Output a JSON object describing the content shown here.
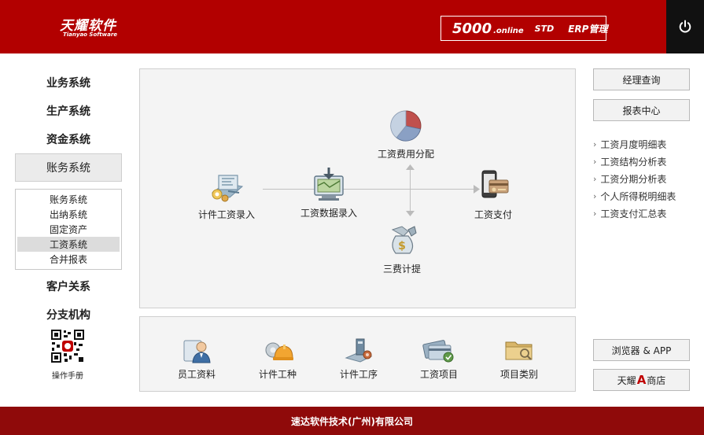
{
  "header": {
    "logo_cn": "天耀软件",
    "logo_en": "Tianyao Software",
    "edition_number": "5000",
    "edition_online": ".online",
    "edition_std": "STD",
    "edition_erp": "ERP管理",
    "power_icon": "power-icon"
  },
  "nav": {
    "items": [
      {
        "label": "业务系统"
      },
      {
        "label": "生产系统"
      },
      {
        "label": "资金系统"
      },
      {
        "label": "账务系统"
      },
      {
        "label": "客户关系"
      },
      {
        "label": "分支机构"
      }
    ],
    "active": "账务系统",
    "submenu": [
      "账务系统",
      "出纳系统",
      "固定资产",
      "工资系统",
      "合并报表"
    ],
    "submenu_selected": "工资系统",
    "qr_label": "操作手册"
  },
  "flow": {
    "nodes": [
      {
        "label": "计件工资录入",
        "icon": "piecework-entry-icon"
      },
      {
        "label": "工资数据录入",
        "icon": "salary-data-entry-icon"
      },
      {
        "label": "工资费用分配",
        "icon": "pie-chart-icon"
      },
      {
        "label": "工资支付",
        "icon": "payment-icon"
      },
      {
        "label": "三费计提",
        "icon": "money-bag-icon"
      }
    ]
  },
  "bottom": {
    "items": [
      {
        "label": "员工资料",
        "icon": "employee-icon"
      },
      {
        "label": "计件工种",
        "icon": "hard-hat-icon"
      },
      {
        "label": "计件工序",
        "icon": "process-icon"
      },
      {
        "label": "工资项目",
        "icon": "salary-card-icon"
      },
      {
        "label": "项目类别",
        "icon": "folder-icon"
      }
    ]
  },
  "right": {
    "manager_query": "经理查询",
    "report_center": "报表中心",
    "reports": [
      "工资月度明细表",
      "工资结构分析表",
      "工资分期分析表",
      "个人所得税明细表",
      "工资支付汇总表"
    ],
    "browser_app": "浏览器 & APP",
    "store_prefix": "天耀",
    "store_mark": "A",
    "store_suffix": "商店"
  },
  "footer": {
    "company": "速达软件技术(广州)有限公司"
  },
  "colors": {
    "brand_red": "#b20000",
    "footer_red": "#8f0a0a",
    "power_bg": "#111111"
  }
}
